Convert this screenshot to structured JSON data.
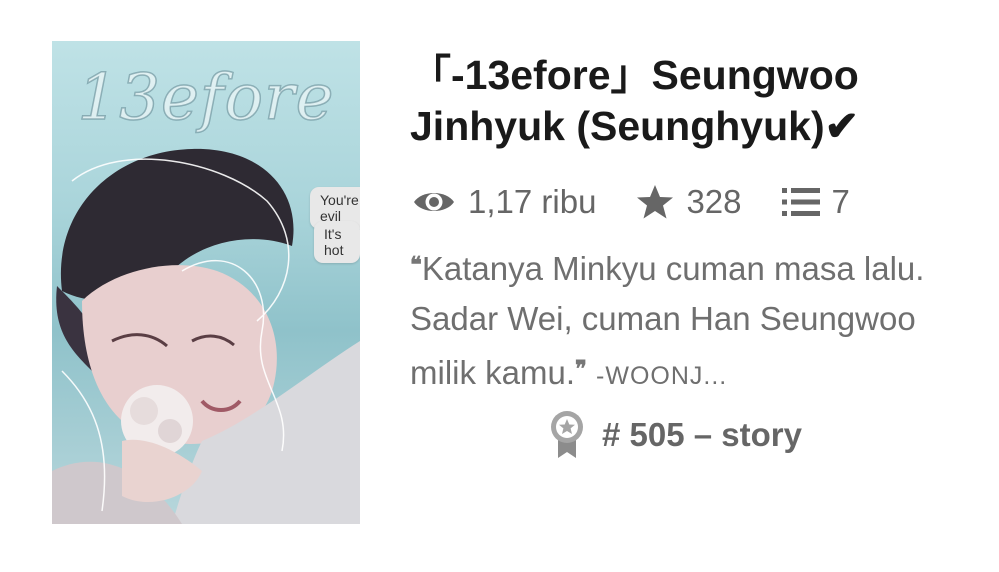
{
  "story": {
    "cover": {
      "title_text": "13efore",
      "bubbles": [
        "You're evil",
        "It's hot"
      ]
    },
    "title": "「-13efore」Seungwoo Jinhyuk (Seunghyuk)✔",
    "stats": {
      "reads": "1,17 ribu",
      "votes": "328",
      "parts": "7"
    },
    "description": {
      "open_quote": "❝",
      "text": "Katanya Minkyu cuman masa lalu. Sadar Wei, cuman Han Seungwoo milik kamu.",
      "close_quote": "❞",
      "author": "-WOONJ..."
    },
    "ranking": {
      "label": "# 505 – story"
    }
  },
  "icons": {
    "reads": "eye-icon",
    "votes": "star-icon",
    "parts": "list-icon",
    "ranking": "ribbon-badge-icon"
  },
  "colors": {
    "title": "#1a1a1a",
    "meta": "#666666",
    "cover_bg": "#a9d4da"
  }
}
